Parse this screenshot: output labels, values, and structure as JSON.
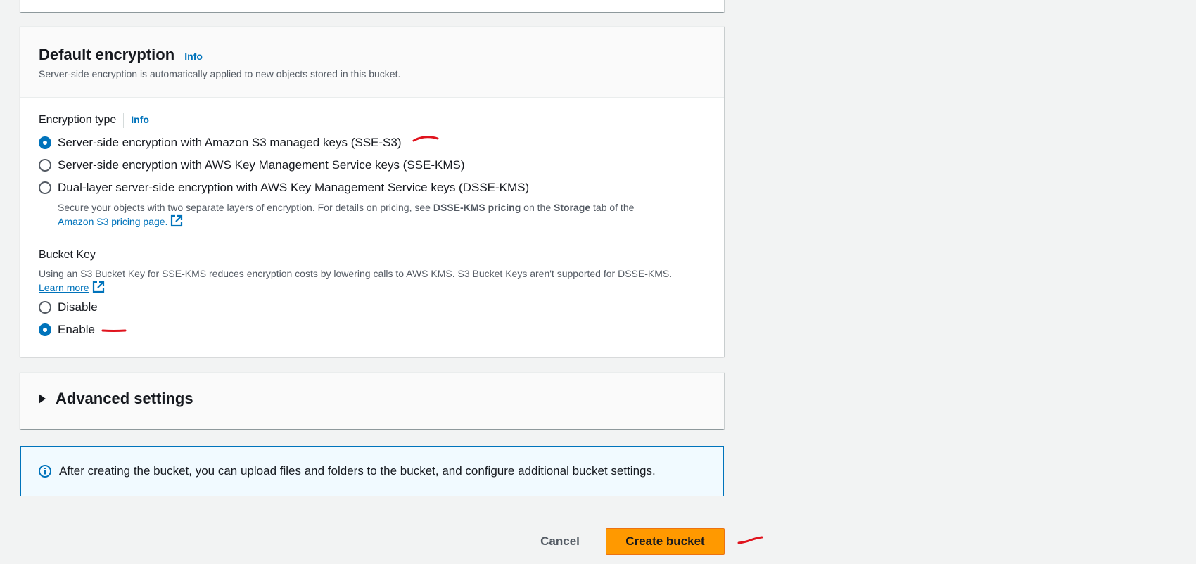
{
  "encryption": {
    "title": "Default encryption",
    "info_label": "Info",
    "description": "Server-side encryption is automatically applied to new objects stored in this bucket.",
    "type_label": "Encryption type",
    "type_info_label": "Info",
    "options": [
      {
        "label": "Server-side encryption with Amazon S3 managed keys (SSE-S3)",
        "selected": true
      },
      {
        "label": "Server-side encryption with AWS Key Management Service keys (SSE-KMS)",
        "selected": false
      },
      {
        "label": "Dual-layer server-side encryption with AWS Key Management Service keys (DSSE-KMS)",
        "selected": false
      }
    ],
    "dsse_desc_prefix": "Secure your objects with two separate layers of encryption. For details on pricing, see ",
    "dsse_desc_bold1": "DSSE-KMS pricing",
    "dsse_desc_mid": " on the ",
    "dsse_desc_bold2": "Storage",
    "dsse_desc_suffix": " tab of the",
    "dsse_link": "Amazon S3 pricing page.",
    "bucket_key": {
      "label": "Bucket Key",
      "description": "Using an S3 Bucket Key for SSE-KMS reduces encryption costs by lowering calls to AWS KMS. S3 Bucket Keys aren't supported for DSSE-KMS.",
      "learn_more": "Learn more",
      "options": [
        {
          "label": "Disable",
          "selected": false
        },
        {
          "label": "Enable",
          "selected": true
        }
      ]
    }
  },
  "advanced": {
    "title": "Advanced settings"
  },
  "alert": {
    "text": "After creating the bucket, you can upload files and folders to the bucket, and configure additional bucket settings."
  },
  "footer": {
    "cancel_label": "Cancel",
    "create_label": "Create bucket"
  },
  "colors": {
    "accent": "#0073bb",
    "primary_button": "#ff9900",
    "annotation": "#e0141e"
  },
  "icons": [
    "external-link-icon",
    "info-circle-icon",
    "caret-right-icon"
  ]
}
